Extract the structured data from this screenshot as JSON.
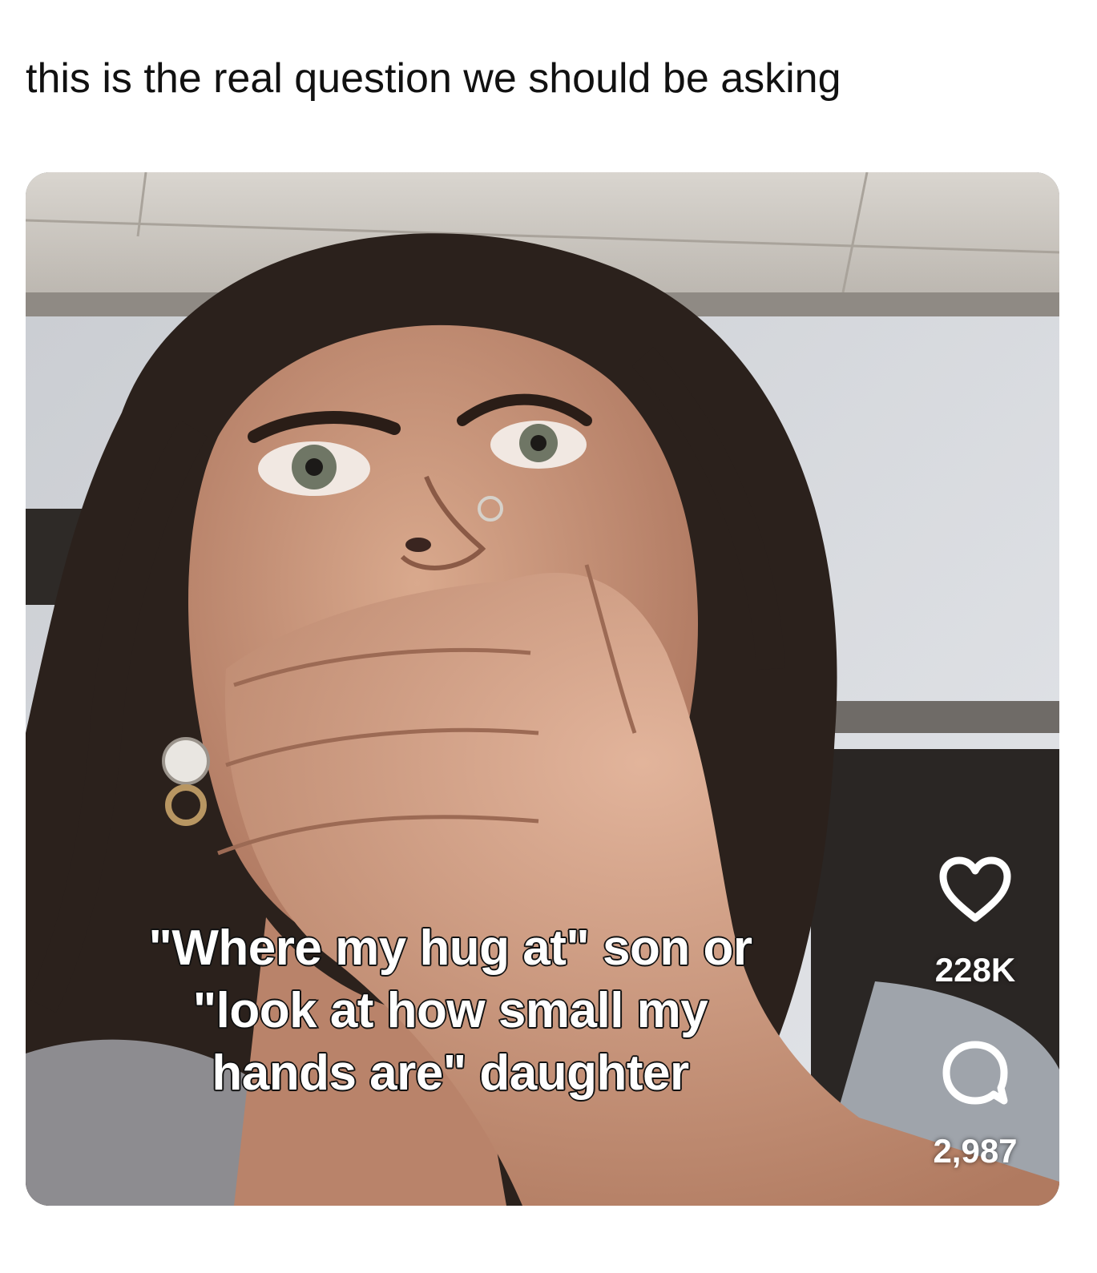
{
  "post": {
    "caption": "this is the real question we should be asking"
  },
  "video": {
    "overlay_lines": [
      "\"Where my hug at\" son or",
      "\"look at how small my",
      "hands are\" daughter"
    ],
    "likes": "228K",
    "comments": "2,987",
    "icons": {
      "like": "heart-icon",
      "comment": "comment-bubble-icon"
    },
    "colors": {
      "overlay_text": "#ffffff",
      "overlay_stroke": "#111111"
    }
  }
}
